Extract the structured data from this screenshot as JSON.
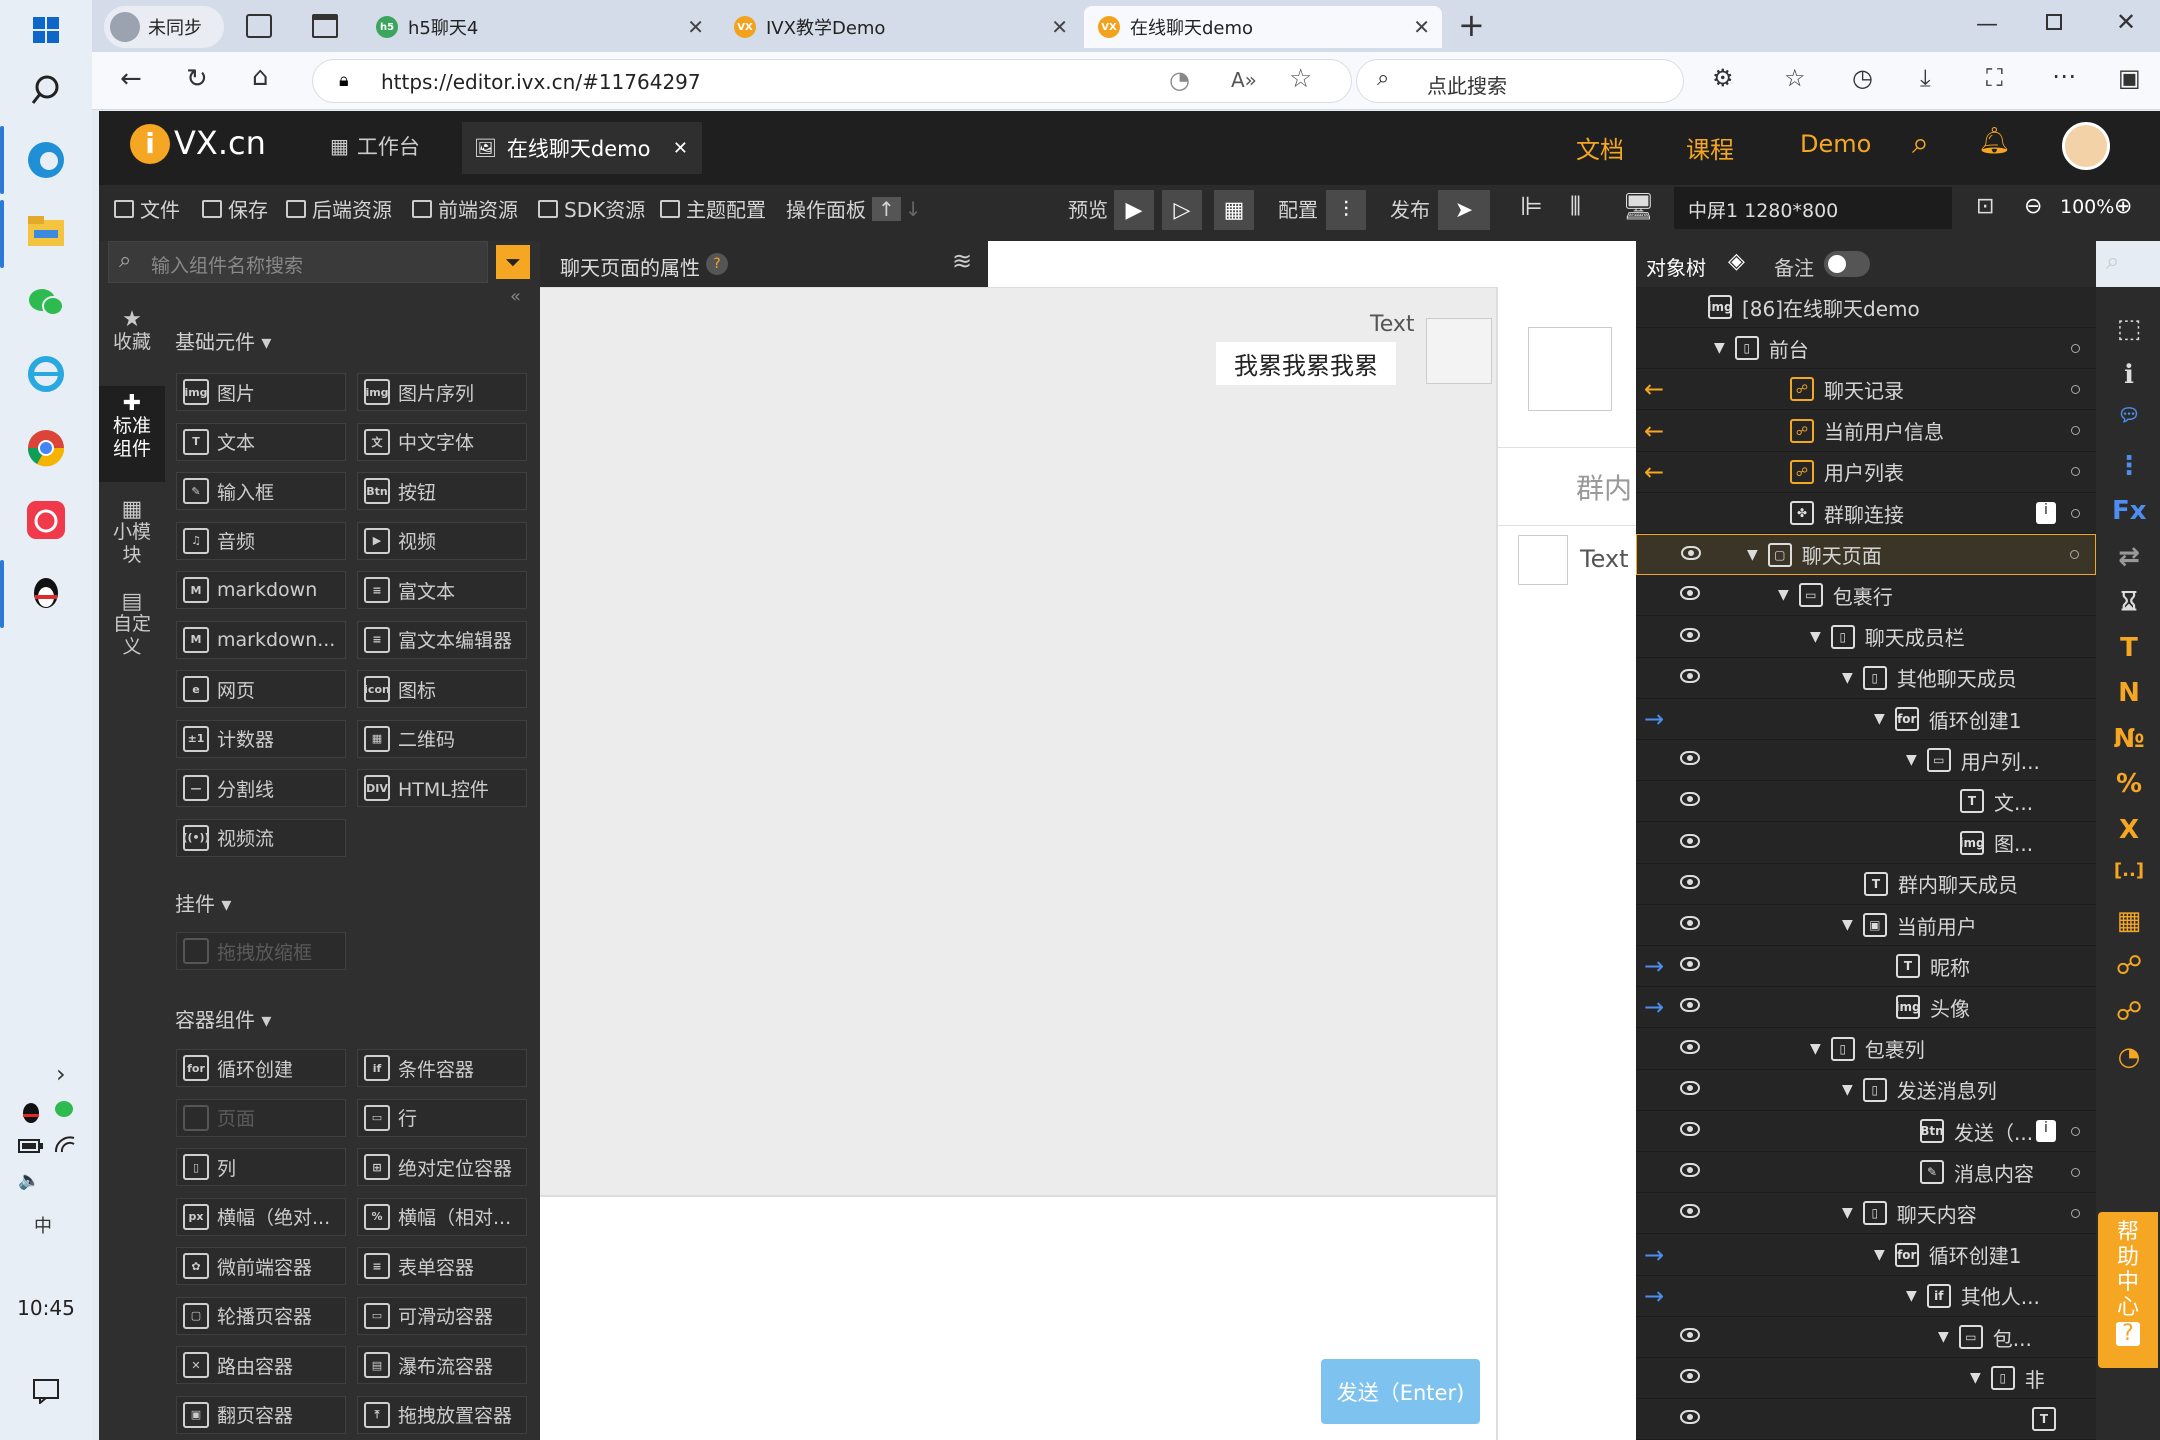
{
  "taskbar": {
    "time": "10:45"
  },
  "browser": {
    "tabs": [
      {
        "label": "未同步"
      },
      {
        "label": "h5聊天4"
      },
      {
        "label": "IVX教学Demo"
      },
      {
        "label": "在线聊天demo"
      }
    ],
    "url": "https://editor.ivx.cn/#11764297",
    "search_placeholder": "点此搜索"
  },
  "ivx": {
    "logo": "VX.cn",
    "tabs": [
      "工作台",
      "在线聊天demo"
    ],
    "nav": [
      "文档",
      "课程",
      "Demo"
    ],
    "toolbar": {
      "file": "文件",
      "save": "保存",
      "backend": "后端资源",
      "frontend": "前端资源",
      "sdk": "SDK资源",
      "theme": "主题配置",
      "panel": "操作面板",
      "preview": "预览",
      "config": "配置",
      "publish": "发布",
      "screen": "中屏1 1280*800",
      "zoom": "100%"
    },
    "sidebar": [
      "收藏",
      "标准组件",
      "小模块",
      "自定义"
    ],
    "search_placeholder": "输入组件名称搜索",
    "sections": {
      "basic": "基础元件",
      "widget": "挂件",
      "container": "容器组件"
    },
    "basic": [
      "图片",
      "图片序列",
      "文本",
      "中文字体",
      "输入框",
      "按钮",
      "音频",
      "视频",
      "markdown",
      "富文本",
      "markdown...",
      "富文本编辑器",
      "网页",
      "图标",
      "计数器",
      "二维码",
      "分割线",
      "HTML控件",
      "视频流"
    ],
    "widgets": [
      "拖拽放缩框"
    ],
    "containers": [
      "循环创建",
      "条件容器",
      "页面",
      "行",
      "列",
      "绝对定位容器",
      "横幅（绝对...",
      "横幅（相对...",
      "微前端容器",
      "表单容器",
      "轮播页容器",
      "可滑动容器",
      "路由容器",
      "瀑布流容器",
      "翻页容器",
      "拖拽放置容器"
    ],
    "props_title": "聊天页面的属性",
    "canvas": {
      "text_label": "Text",
      "message": "我累我累我累",
      "group_label": "群内",
      "text2": "Text",
      "send": "发送（Enter)"
    },
    "tree": {
      "header": "对象树",
      "note": "备注",
      "rows": [
        "[86]在线聊天demo",
        "前台",
        "聊天记录",
        "当前用户信息",
        "用户列表",
        "群聊连接",
        "聊天页面",
        "包裹行",
        "聊天成员栏",
        "其他聊天成员",
        "循环创建1",
        "用户列...",
        "文...",
        "图...",
        "群内聊天成员",
        "当前用户",
        "昵称",
        "头像",
        "包裹列",
        "发送消息列",
        "发送（...",
        "消息内容",
        "聊天内容",
        "循环创建1",
        "其他人...",
        "包...",
        "非",
        ""
      ]
    },
    "help": "帮助中心"
  }
}
